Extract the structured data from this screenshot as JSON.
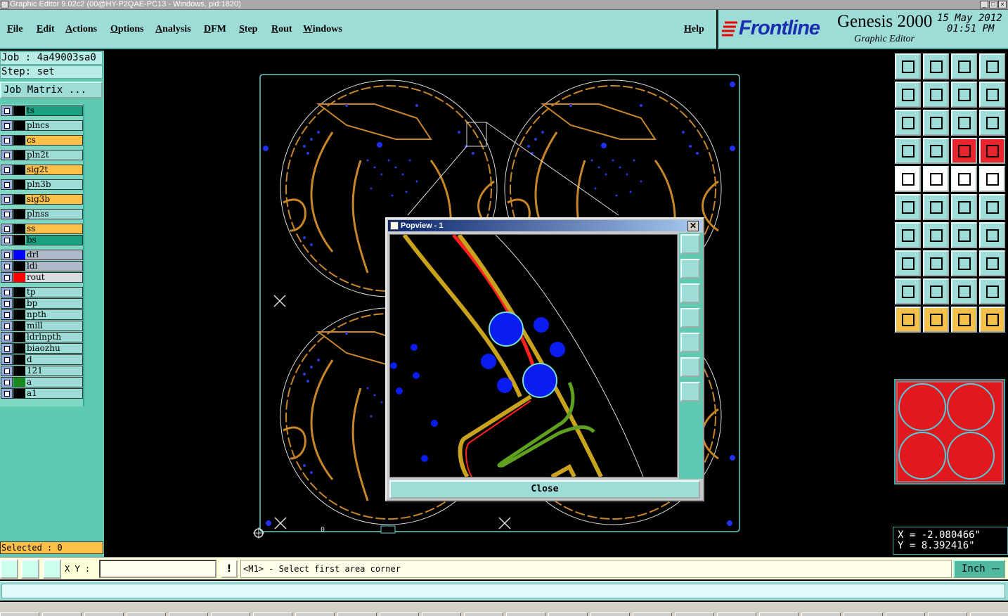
{
  "window": {
    "title": "Graphic Editor 9.02c2 (00@HY-P2QAE-PC13 - Windows, pid:1820)"
  },
  "menu": {
    "items": [
      "File",
      "Edit",
      "Actions",
      "Options",
      "Analysis",
      "DFM",
      "Step",
      "Rout",
      "Windows"
    ],
    "help": "Help"
  },
  "brand": {
    "logo": "Frontline",
    "product": "Genesis 2000",
    "subtitle": "Graphic Editor",
    "date": "15 May 2012",
    "time": "01:51 PM"
  },
  "job": {
    "job_label": "Job : 4a49003sa0",
    "step_label": "Step: set",
    "matrix_button": "Job Matrix ..."
  },
  "layers": [
    {
      "name": "ts",
      "color": "#000000",
      "bg": "#1aa082"
    },
    {
      "name": "plncs",
      "color": "#000000",
      "bg": "#9edcd8"
    },
    {
      "name": "cs",
      "color": "#000000",
      "bg": "#ffc04a"
    },
    {
      "name": "pln2t",
      "color": "#000000",
      "bg": "#9edcd8"
    },
    {
      "name": "sig2t",
      "color": "#000000",
      "bg": "#ffc04a"
    },
    {
      "name": "pln3b",
      "color": "#000000",
      "bg": "#9edcd8"
    },
    {
      "name": "sig3b",
      "color": "#000000",
      "bg": "#ffc04a"
    },
    {
      "name": "plnss",
      "color": "#000000",
      "bg": "#9edcd8"
    },
    {
      "name": "ss",
      "color": "#000000",
      "bg": "#ffc04a"
    },
    {
      "name": "bs",
      "color": "#000000",
      "bg": "#1aa082"
    },
    {
      "name": "drl",
      "color": "#0000ff",
      "bg": "#aebac8"
    },
    {
      "name": "ldi",
      "color": "#000000",
      "bg": "#aebac8"
    },
    {
      "name": "rout",
      "color": "#ff0000",
      "bg": "#d8dce0"
    },
    {
      "name": "tp",
      "color": "#000000",
      "bg": "#9edcd8"
    },
    {
      "name": "bp",
      "color": "#000000",
      "bg": "#9edcd8"
    },
    {
      "name": "npth",
      "color": "#000000",
      "bg": "#9edcd8"
    },
    {
      "name": "mill",
      "color": "#000000",
      "bg": "#9edcd8"
    },
    {
      "name": "ldrlnpth",
      "color": "#000000",
      "bg": "#9edcd8"
    },
    {
      "name": "biaozhu",
      "color": "#000000",
      "bg": "#9edcd8"
    },
    {
      "name": "d",
      "color": "#000000",
      "bg": "#9edcd8"
    },
    {
      "name": "121",
      "color": "#000000",
      "bg": "#9edcd8"
    },
    {
      "name": "a",
      "color": "#1a8a20",
      "bg": "#9edcd8"
    },
    {
      "name": "a1",
      "color": "#000000",
      "bg": "#9edcd8"
    }
  ],
  "selected": "Selected : 0",
  "canvas": {
    "origin_label": "0"
  },
  "popview": {
    "title": "Popview - 1",
    "close_x": "✕",
    "close_button": "Close"
  },
  "coords": {
    "x": "X = -2.080466\"",
    "y": "Y = 8.392416\""
  },
  "cmd": {
    "xy_label": "X Y :",
    "xy_value": "",
    "bang": "!",
    "prompt": "<M1> - Select first area corner",
    "unit": "Inch"
  },
  "icons": [
    "open-icon",
    "save-icon",
    "home-icon",
    "window-icon",
    "prev-icon",
    "next-icon",
    "undo-icon",
    "redo-icon",
    "zoom-fit-icon",
    "zoom-center-icon",
    "zoom-ratio-icon",
    "help-icon",
    "measure-icon",
    "snap-icon",
    "layer-icon",
    "layer2-icon",
    "pad-icon",
    "slash-icon",
    "ruler-icon",
    "circle-icon",
    "network-icon",
    "cross-icon",
    "arc-icon",
    "arc2-icon",
    "line-icon",
    "line2-icon",
    "rotate-icon",
    "mirror-icon",
    "move-icon",
    "minus-icon",
    "resize-icon",
    "duplicate-icon",
    "triangle-icon",
    "triangle2-icon",
    "triangle3-icon",
    "triangle4-icon",
    "pointer-icon",
    "pointer2-icon",
    "pointer3-icon",
    "tree-icon"
  ],
  "colors": {
    "panel": "#9edcd8",
    "panel_dark": "#5fc9b2",
    "accent_red": "#e8242c",
    "accent_yellow": "#ffc04a",
    "board_outline": "#6cc"
  }
}
